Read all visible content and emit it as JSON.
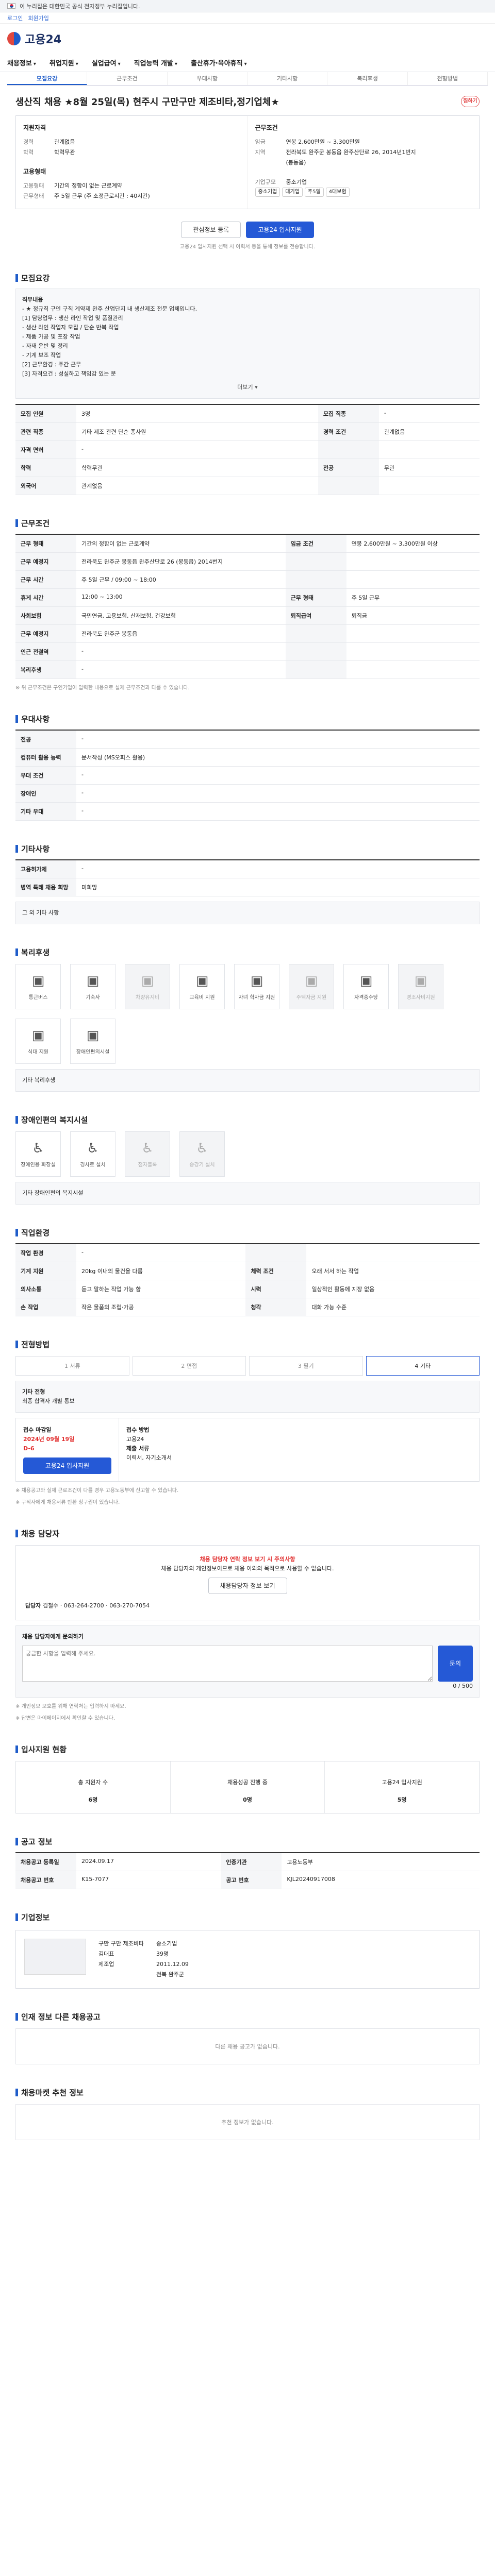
{
  "gov_bar": {
    "text": "이 누리집은 대한민국 공식 전자정부 누리집입니다."
  },
  "subbar": {
    "login": "로그인",
    "join": "회원가입"
  },
  "brand": {
    "name": "고용24"
  },
  "gnb": [
    "채용정보",
    "취업지원",
    "실업급여",
    "직업능력 개발",
    "출산휴가·육아휴직"
  ],
  "tabs": [
    "모집요강",
    "근무조건",
    "우대사항",
    "기타사항",
    "복리후생",
    "전형방법"
  ],
  "title": "생산직 채용 ★8월 25일(목) 현주시 구만구만 제조비타,정기업체★",
  "star_label": "찜하기",
  "summary": {
    "left_h": "지원자격",
    "left": [
      {
        "k": "경력",
        "v": "관계없음"
      },
      {
        "k": "학력",
        "v": "학력무관"
      }
    ],
    "right_h": "근무조건",
    "right": [
      {
        "k": "임금",
        "v": "연봉 2,600만원 ~ 3,300만원"
      },
      {
        "k": "지역",
        "v": "전라북도 완주군 봉동읍 완주산단로 26, 2014년1번지"
      },
      {
        "k": "",
        "v": "(봉동읍)"
      }
    ],
    "left2_h": "고용형태",
    "left2": [
      {
        "k": "고용형태",
        "v": "기간의 정함이 없는 근로계약"
      },
      {
        "k": "근무형태",
        "v": "주 5일 근무 (주 소정근로시간 : 40시간)"
      }
    ],
    "right2_h": "",
    "right2": [
      {
        "k": "기업규모",
        "v": "중소기업"
      }
    ],
    "tags": [
      "중소기업",
      "대기업",
      "주5일",
      "4대보험"
    ]
  },
  "btn": {
    "list": "관심정보 등록",
    "apply": "고용24 입사지원"
  },
  "note": "고용24 입사지원 선택 시 이력서 등을 통해 정보를 전송합니다.",
  "s1": "모집요강",
  "duty_title": "직무내용",
  "duty": [
    "- ★ 정규직 구인 구직 계약제 완주 산업단지 내 생산제조 전문 업체입니다.",
    "[1] 담당업무 : 생산 라인 작업 및 품질관리",
    "- 생산 라인 작업자 모집 / 단순 반복 작업",
    "- 제품 가공 및 포장 작업",
    "- 자재 운반 및 정리",
    "- 기계 보조 작업",
    "[2] 근무환경 : 주간 근무",
    "[3] 자격요건 : 성실하고 책임감 있는 분"
  ],
  "more": "더보기 ▾",
  "req": [
    {
      "k": "모집 인원",
      "v": "3명",
      "k2": "모집 직종",
      "v2": "-"
    },
    {
      "k": "관련 직종",
      "v": "기타 제조 관련 단순 종사원",
      "k2": "경력 조건",
      "v2": "관계없음"
    },
    {
      "k": "자격 면허",
      "v": "-",
      "k2": "",
      "v2": ""
    },
    {
      "k": "학력",
      "v": "학력무관",
      "k2": "전공",
      "v2": "무관"
    },
    {
      "k": "외국어",
      "v": "관계없음",
      "k2": "",
      "v2": ""
    }
  ],
  "s2": "근무조건",
  "work": [
    {
      "k": "근무 형태",
      "v": "기간의 정함이 없는 근로계약",
      "k2": "임금 조건",
      "v2": "연봉 2,600만원 ~ 3,300만원 이상"
    },
    {
      "k": "근무 예정지",
      "v": "전라북도 완주군 봉동읍 완주산단로 26 (봉동읍) 2014번지",
      "k2": "",
      "v2": ""
    },
    {
      "k": "근무 시간",
      "v": "주 5일 근무 / 09:00 ~ 18:00",
      "k2": "",
      "v2": ""
    },
    {
      "k": "휴게 시간",
      "v": "12:00 ~ 13:00",
      "k2": "근무 형태",
      "v2": "주 5일 근무"
    },
    {
      "k": "사회보험",
      "v": "국민연금, 고용보험, 산재보험, 건강보험",
      "k2": "퇴직급여",
      "v2": "퇴직금"
    },
    {
      "k": "근무 예정지",
      "v": "전라북도 완주군 봉동읍",
      "k2": "",
      "v2": ""
    },
    {
      "k": "인근 전철역",
      "v": "-",
      "k2": "",
      "v2": ""
    },
    {
      "k": "복리후생",
      "v": "-",
      "k2": "",
      "v2": ""
    }
  ],
  "work_note": "※ 위 근무조건은 구인기업이 입력한 내용으로 실제 근무조건과 다를 수 있습니다.",
  "s3": "우대사항",
  "pref": [
    {
      "k": "전공",
      "v": "-"
    },
    {
      "k": "컴퓨터 활용 능력",
      "v": "문서작성 (MS오피스 활용)"
    },
    {
      "k": "우대 조건",
      "v": "-"
    },
    {
      "k": "장애인",
      "v": "-"
    },
    {
      "k": "기타 우대",
      "v": "-"
    }
  ],
  "s4": "기타사항",
  "etc": [
    {
      "k": "고용허가제",
      "v": "-"
    },
    {
      "k": "병역 특례 채용 희망",
      "v": "미희망"
    }
  ],
  "etc_more": "그 외 기타 사항",
  "s5": "복리후생",
  "welfare": [
    {
      "l": "통근버스",
      "o": false
    },
    {
      "l": "기숙사",
      "o": false
    },
    {
      "l": "차량유지비",
      "o": true
    },
    {
      "l": "교육비 지원",
      "o": false
    },
    {
      "l": "자녀 학자금 지원",
      "o": false
    },
    {
      "l": "주택자금 지원",
      "o": true
    },
    {
      "l": "자격증수당",
      "o": false
    },
    {
      "l": "경조사비지원",
      "o": true
    },
    {
      "l": "식대 지원",
      "o": false
    },
    {
      "l": "장애인편의시설",
      "o": false
    }
  ],
  "welfare_etc": "기타 복리후생",
  "s6": "장애인편의 복지시설",
  "facility": [
    {
      "l": "장애인용 화장실",
      "o": false
    },
    {
      "l": "경사로 설치",
      "o": false
    },
    {
      "l": "점자블록",
      "o": true
    },
    {
      "l": "승강기 설치",
      "o": true
    }
  ],
  "facility_etc": "기타 장애인편의 복지시설",
  "s7": "직업환경",
  "env": [
    {
      "k": "작업 환경",
      "v": "-",
      "k2": "",
      "v2": ""
    },
    {
      "k": "기계 지원",
      "v": "20kg 이내의 물건을 다룸",
      "k2": "체력 조건",
      "v2": "오래 서서 하는 작업"
    },
    {
      "k": "의사소통",
      "v": "듣고 말하는 작업 가능 함",
      "k2": "시력",
      "v2": "일상적인 활동에 지장 없음"
    },
    {
      "k": "손 작업",
      "v": "작은 물품의 조립·가공",
      "k2": "청각",
      "v2": "대화 가능 수준"
    }
  ],
  "s8": "전형방법",
  "steps": [
    {
      "l": "1 서류",
      "o": false
    },
    {
      "l": "2 면접",
      "o": false
    },
    {
      "l": "3 필기",
      "o": false
    },
    {
      "l": "4 기타",
      "o": true
    }
  ],
  "step_etc": "기타 전형",
  "step_etc_v": "최종 합격자 개별 통보",
  "deadline": {
    "h": "접수 마감일",
    "date": "2024년 09월 19일",
    "left": "D-6",
    "h2": "접수 방법",
    "way": "고용24",
    "docs_h": "제출 서류",
    "docs": "이력서, 자기소개서",
    "btn": "고용24 입사지원"
  },
  "warn_lines": [
    "※ 채용공고와 실제 근로조건이 다를 경우 고용노동부에 신고할 수 있습니다.",
    "※ 구직자에게 채용서류 반환 청구권이 있습니다."
  ],
  "s9": "채용 담당자",
  "contact": {
    "alert": "채용 담당자 연락 정보 보기 시 주의사항",
    "msg": "채용 담당자의 개인정보이므로 채용 이외의 목적으로 사용할 수 없습니다.",
    "btn": "채용담당자 정보 보기",
    "name_h": "담당자",
    "name": "김철수",
    "tel": "063-264-2700",
    "fax": "063-270-7054"
  },
  "inq": {
    "h": "채용 담당자에게 문의하기",
    "placeholder": "궁금한 사항을 입력해 주세요.",
    "count": "0 / 500",
    "btn": "문의"
  },
  "inq_notes": [
    "※ 개인정보 보호를 위해 연락처는 입력하지 마세요.",
    "※ 답변은 마이페이지에서 확인할 수 있습니다."
  ],
  "s10": "입사지원 현황",
  "stat": [
    {
      "l": "총 지원자 수",
      "v": "6명"
    },
    {
      "l": "채용성공 진행 중",
      "v": "0명"
    },
    {
      "l": "고용24 입사지원",
      "v": "5명"
    }
  ],
  "s11": "공고 정보",
  "info": [
    {
      "k": "채용공고 등록일",
      "v": "2024.09.17",
      "k2": "인증기관",
      "v2": "고용노동부"
    },
    {
      "k": "채용공고 번호",
      "v": "K15-7077",
      "k2": "공고 번호",
      "v2": "KJL20240917008"
    }
  ],
  "s12": "기업정보",
  "company": {
    "name": "구만 구만 제조비타",
    "ceo": "김대표",
    "type": "제조업",
    "size": "중소기업",
    "emp": "39명",
    "year": "2011.12.09",
    "addr": "전북 완주군"
  },
  "s13": "인재 정보 다른 채용공고",
  "s13_empty": "다른 채용 공고가 없습니다.",
  "s14": "채용마켓 추천 정보",
  "s14_empty": "추천 정보가 없습니다."
}
